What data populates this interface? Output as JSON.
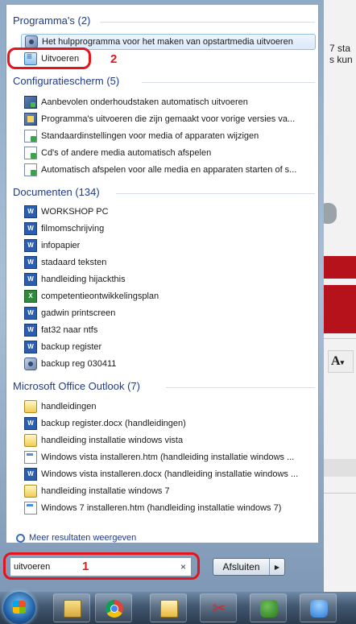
{
  "background_app": {
    "text_lines": [
      "7 sta",
      "s kun"
    ]
  },
  "sections": [
    {
      "header": "Programma's (2)",
      "items": [
        {
          "label": "Het hulpprogramma voor het maken van opstartmedia uitvoeren",
          "icon": "recovery-media-icon"
        },
        {
          "label": "Uitvoeren",
          "icon": "run-icon"
        }
      ]
    },
    {
      "header": "Configuratiescherm (5)",
      "items": [
        {
          "label": "Aanbevolen onderhoudstaken automatisch uitvoeren",
          "icon": "control-panel-icon"
        },
        {
          "label": "Programma's uitvoeren die zijn gemaakt voor vorige versies va...",
          "icon": "program-compat-icon"
        },
        {
          "label": "Standaardinstellingen voor media of apparaten wijzigen",
          "icon": "autoplay-icon"
        },
        {
          "label": "Cd's of andere media automatisch afspelen",
          "icon": "autoplay-icon"
        },
        {
          "label": "Automatisch afspelen voor alle media en apparaten starten of s...",
          "icon": "autoplay-icon"
        }
      ]
    },
    {
      "header": "Documenten (134)",
      "items": [
        {
          "label": "WORKSHOP PC",
          "icon": "word-doc-icon"
        },
        {
          "label": "filmomschrijving",
          "icon": "word-doc-icon"
        },
        {
          "label": "infopapier",
          "icon": "word-doc-icon"
        },
        {
          "label": "stadaard teksten",
          "icon": "word-doc-icon"
        },
        {
          "label": "handleiding hijackthis",
          "icon": "word-doc-icon"
        },
        {
          "label": "competentieontwikkelingsplan",
          "icon": "excel-doc-icon"
        },
        {
          "label": "gadwin printscreen",
          "icon": "word-doc-icon"
        },
        {
          "label": "fat32 naar ntfs",
          "icon": "word-doc-icon"
        },
        {
          "label": "backup register",
          "icon": "word-doc-icon"
        },
        {
          "label": "backup reg 030411",
          "icon": "registry-file-icon"
        }
      ]
    },
    {
      "header": "Microsoft Office Outlook (7)",
      "items": [
        {
          "label": "handleidingen",
          "icon": "mail-icon"
        },
        {
          "label": "backup register.docx (handleidingen)",
          "icon": "word-doc-icon"
        },
        {
          "label": "handleiding installatie windows vista",
          "icon": "mail-icon"
        },
        {
          "label": "Windows vista installeren.htm (handleiding installatie windows ...",
          "icon": "htm-file-icon"
        },
        {
          "label": "Windows vista installeren.docx (handleiding installatie windows ...",
          "icon": "word-doc-icon"
        },
        {
          "label": "handleiding installatie windows 7",
          "icon": "mail-icon"
        },
        {
          "label": "Windows 7 installeren.htm (handleiding installatie windows 7)",
          "icon": "htm-file-icon"
        }
      ]
    }
  ],
  "more_results": "Meer resultaten weergeven",
  "search": {
    "value": "uitvoeren",
    "clear": "×"
  },
  "shutdown": {
    "label": "Afsluiten",
    "arrow": "▶"
  },
  "annotations": {
    "one": "1",
    "two": "2"
  },
  "taskbar": {
    "items": [
      "start-orb",
      "explorer",
      "chrome",
      "outlook",
      "snipping-tool",
      "users",
      "messenger"
    ]
  },
  "colors": {
    "header": "#1e3a8a",
    "annotation_red": "#e3141b"
  }
}
